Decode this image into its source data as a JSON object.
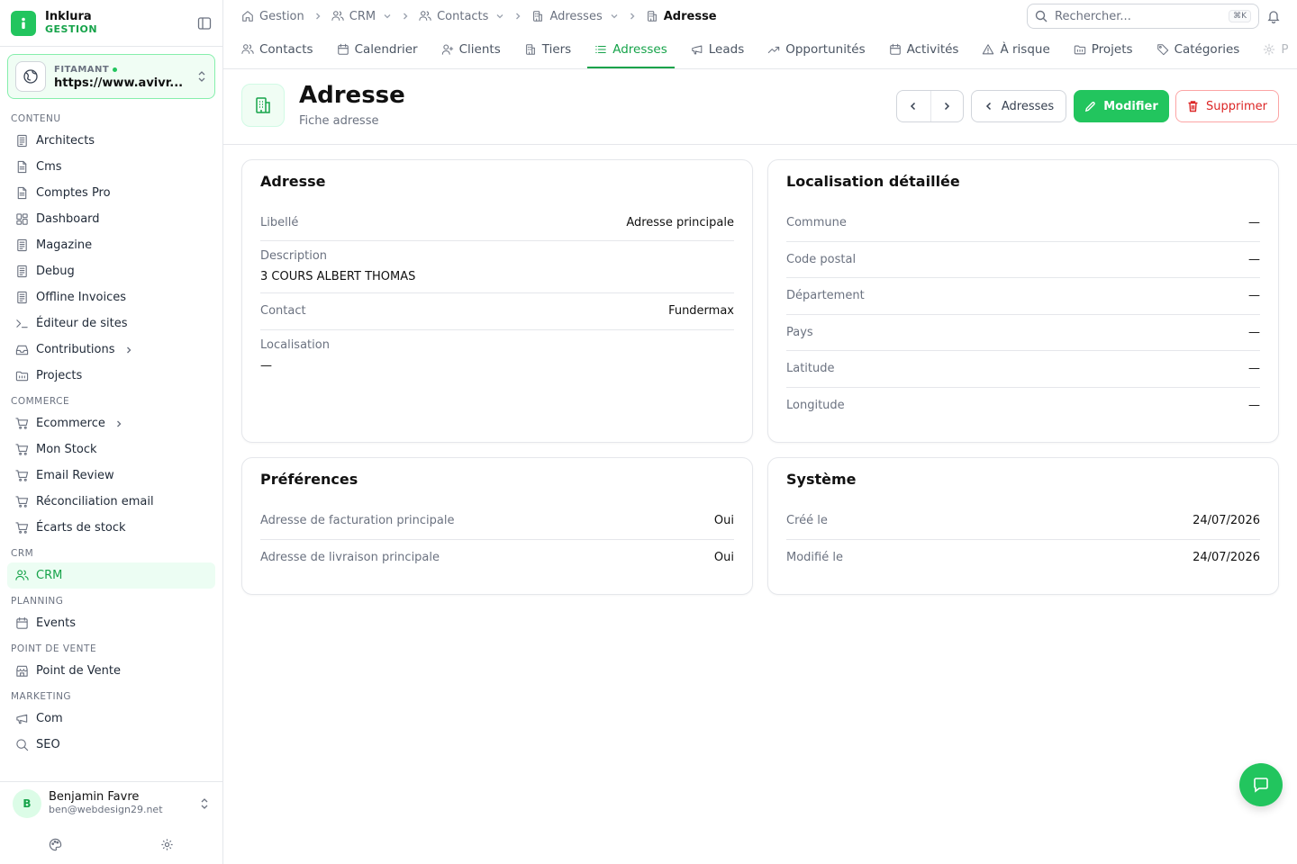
{
  "brand": {
    "name": "Inklura",
    "sub": "GESTION"
  },
  "workspace": {
    "label": "FITAMANT",
    "url": "https://www.avivr..."
  },
  "sidebar": {
    "sections": [
      {
        "title": "CONTENU",
        "items": [
          {
            "label": "Architects",
            "icon": "doc-grid-icon"
          },
          {
            "label": "Cms",
            "icon": "file-icon"
          },
          {
            "label": "Comptes Pro",
            "icon": "file-icon"
          },
          {
            "label": "Dashboard",
            "icon": "dashboard-icon"
          },
          {
            "label": "Magazine",
            "icon": "doc-grid-icon"
          },
          {
            "label": "Debug",
            "icon": "doc-grid-icon"
          },
          {
            "label": "Offline Invoices",
            "icon": "doc-grid-icon"
          },
          {
            "label": "Éditeur de sites",
            "icon": "terminal-icon"
          },
          {
            "label": "Contributions",
            "icon": "inbox-icon",
            "chevron": true
          },
          {
            "label": "Projects",
            "icon": "folder-icon"
          }
        ]
      },
      {
        "title": "COMMERCE",
        "items": [
          {
            "label": "Ecommerce",
            "icon": "cart-icon",
            "chevron": true
          },
          {
            "label": "Mon Stock",
            "icon": "cart-icon"
          },
          {
            "label": "Email Review",
            "icon": "cart-icon"
          },
          {
            "label": "Réconciliation email",
            "icon": "cart-icon"
          },
          {
            "label": "Écarts de stock",
            "icon": "cart-icon"
          }
        ]
      },
      {
        "title": "CRM",
        "items": [
          {
            "label": "CRM",
            "icon": "users-icon",
            "active": true
          }
        ]
      },
      {
        "title": "PLANNING",
        "items": [
          {
            "label": "Events",
            "icon": "calendar-icon"
          }
        ]
      },
      {
        "title": "POINT DE VENTE",
        "items": [
          {
            "label": "Point de Vente",
            "icon": "store-icon"
          }
        ]
      },
      {
        "title": "MARKETING",
        "items": [
          {
            "label": "Com",
            "icon": "megaphone-icon"
          },
          {
            "label": "SEO",
            "icon": "search-icon"
          }
        ]
      }
    ]
  },
  "user": {
    "initial": "B",
    "name": "Benjamin Favre",
    "email": "ben@webdesign29.net"
  },
  "breadcrumb": [
    {
      "label": "Gestion",
      "icon": "home-icon"
    },
    {
      "label": "CRM",
      "icon": "users-icon",
      "dropdown": true
    },
    {
      "label": "Contacts",
      "icon": "users-icon",
      "dropdown": true
    },
    {
      "label": "Adresses",
      "icon": "building-icon",
      "dropdown": true
    },
    {
      "label": "Adresse",
      "icon": "building-icon",
      "current": true
    }
  ],
  "search": {
    "placeholder": "Rechercher...",
    "shortcut": "⌘K"
  },
  "tabs": [
    {
      "label": "Contacts",
      "icon": "users-icon"
    },
    {
      "label": "Calendrier",
      "icon": "calendar-icon"
    },
    {
      "label": "Clients",
      "icon": "user-plus-icon"
    },
    {
      "label": "Tiers",
      "icon": "building-icon"
    },
    {
      "label": "Adresses",
      "icon": "list-icon",
      "active": true
    },
    {
      "label": "Leads",
      "icon": "megaphone-icon"
    },
    {
      "label": "Opportunités",
      "icon": "trend-icon"
    },
    {
      "label": "Activités",
      "icon": "calendar-icon"
    },
    {
      "label": "À risque",
      "icon": "warning-icon"
    },
    {
      "label": "Projets",
      "icon": "folder-icon"
    },
    {
      "label": "Catégories",
      "icon": "tag-icon"
    },
    {
      "label": "P",
      "icon": "gear-icon"
    }
  ],
  "page": {
    "title": "Adresse",
    "subtitle": "Fiche adresse",
    "back_label": "Adresses",
    "edit_label": "Modifier",
    "delete_label": "Supprimer"
  },
  "cards": {
    "adresse": {
      "title": "Adresse",
      "libelle_label": "Libellé",
      "libelle_value": "Adresse principale",
      "description_label": "Description",
      "description_value": "3 COURS ALBERT THOMAS",
      "contact_label": "Contact",
      "contact_value": "Fundermax",
      "localisation_label": "Localisation",
      "localisation_value": "—"
    },
    "localisation": {
      "title": "Localisation détaillée",
      "rows": [
        {
          "label": "Commune",
          "value": "—"
        },
        {
          "label": "Code postal",
          "value": "—"
        },
        {
          "label": "Département",
          "value": "—"
        },
        {
          "label": "Pays",
          "value": "—"
        },
        {
          "label": "Latitude",
          "value": "—"
        },
        {
          "label": "Longitude",
          "value": "—"
        }
      ]
    },
    "preferences": {
      "title": "Préférences",
      "rows": [
        {
          "label": "Adresse de facturation principale",
          "value": "Oui"
        },
        {
          "label": "Adresse de livraison principale",
          "value": "Oui"
        }
      ]
    },
    "systeme": {
      "title": "Système",
      "rows": [
        {
          "label": "Créé le",
          "value": "24/07/2026"
        },
        {
          "label": "Modifié le",
          "value": "24/07/2026"
        }
      ]
    }
  },
  "colors": {
    "accent": "#22c55e",
    "accent_dark": "#16a34a",
    "danger": "#dc2626",
    "border": "#e5e7eb"
  }
}
